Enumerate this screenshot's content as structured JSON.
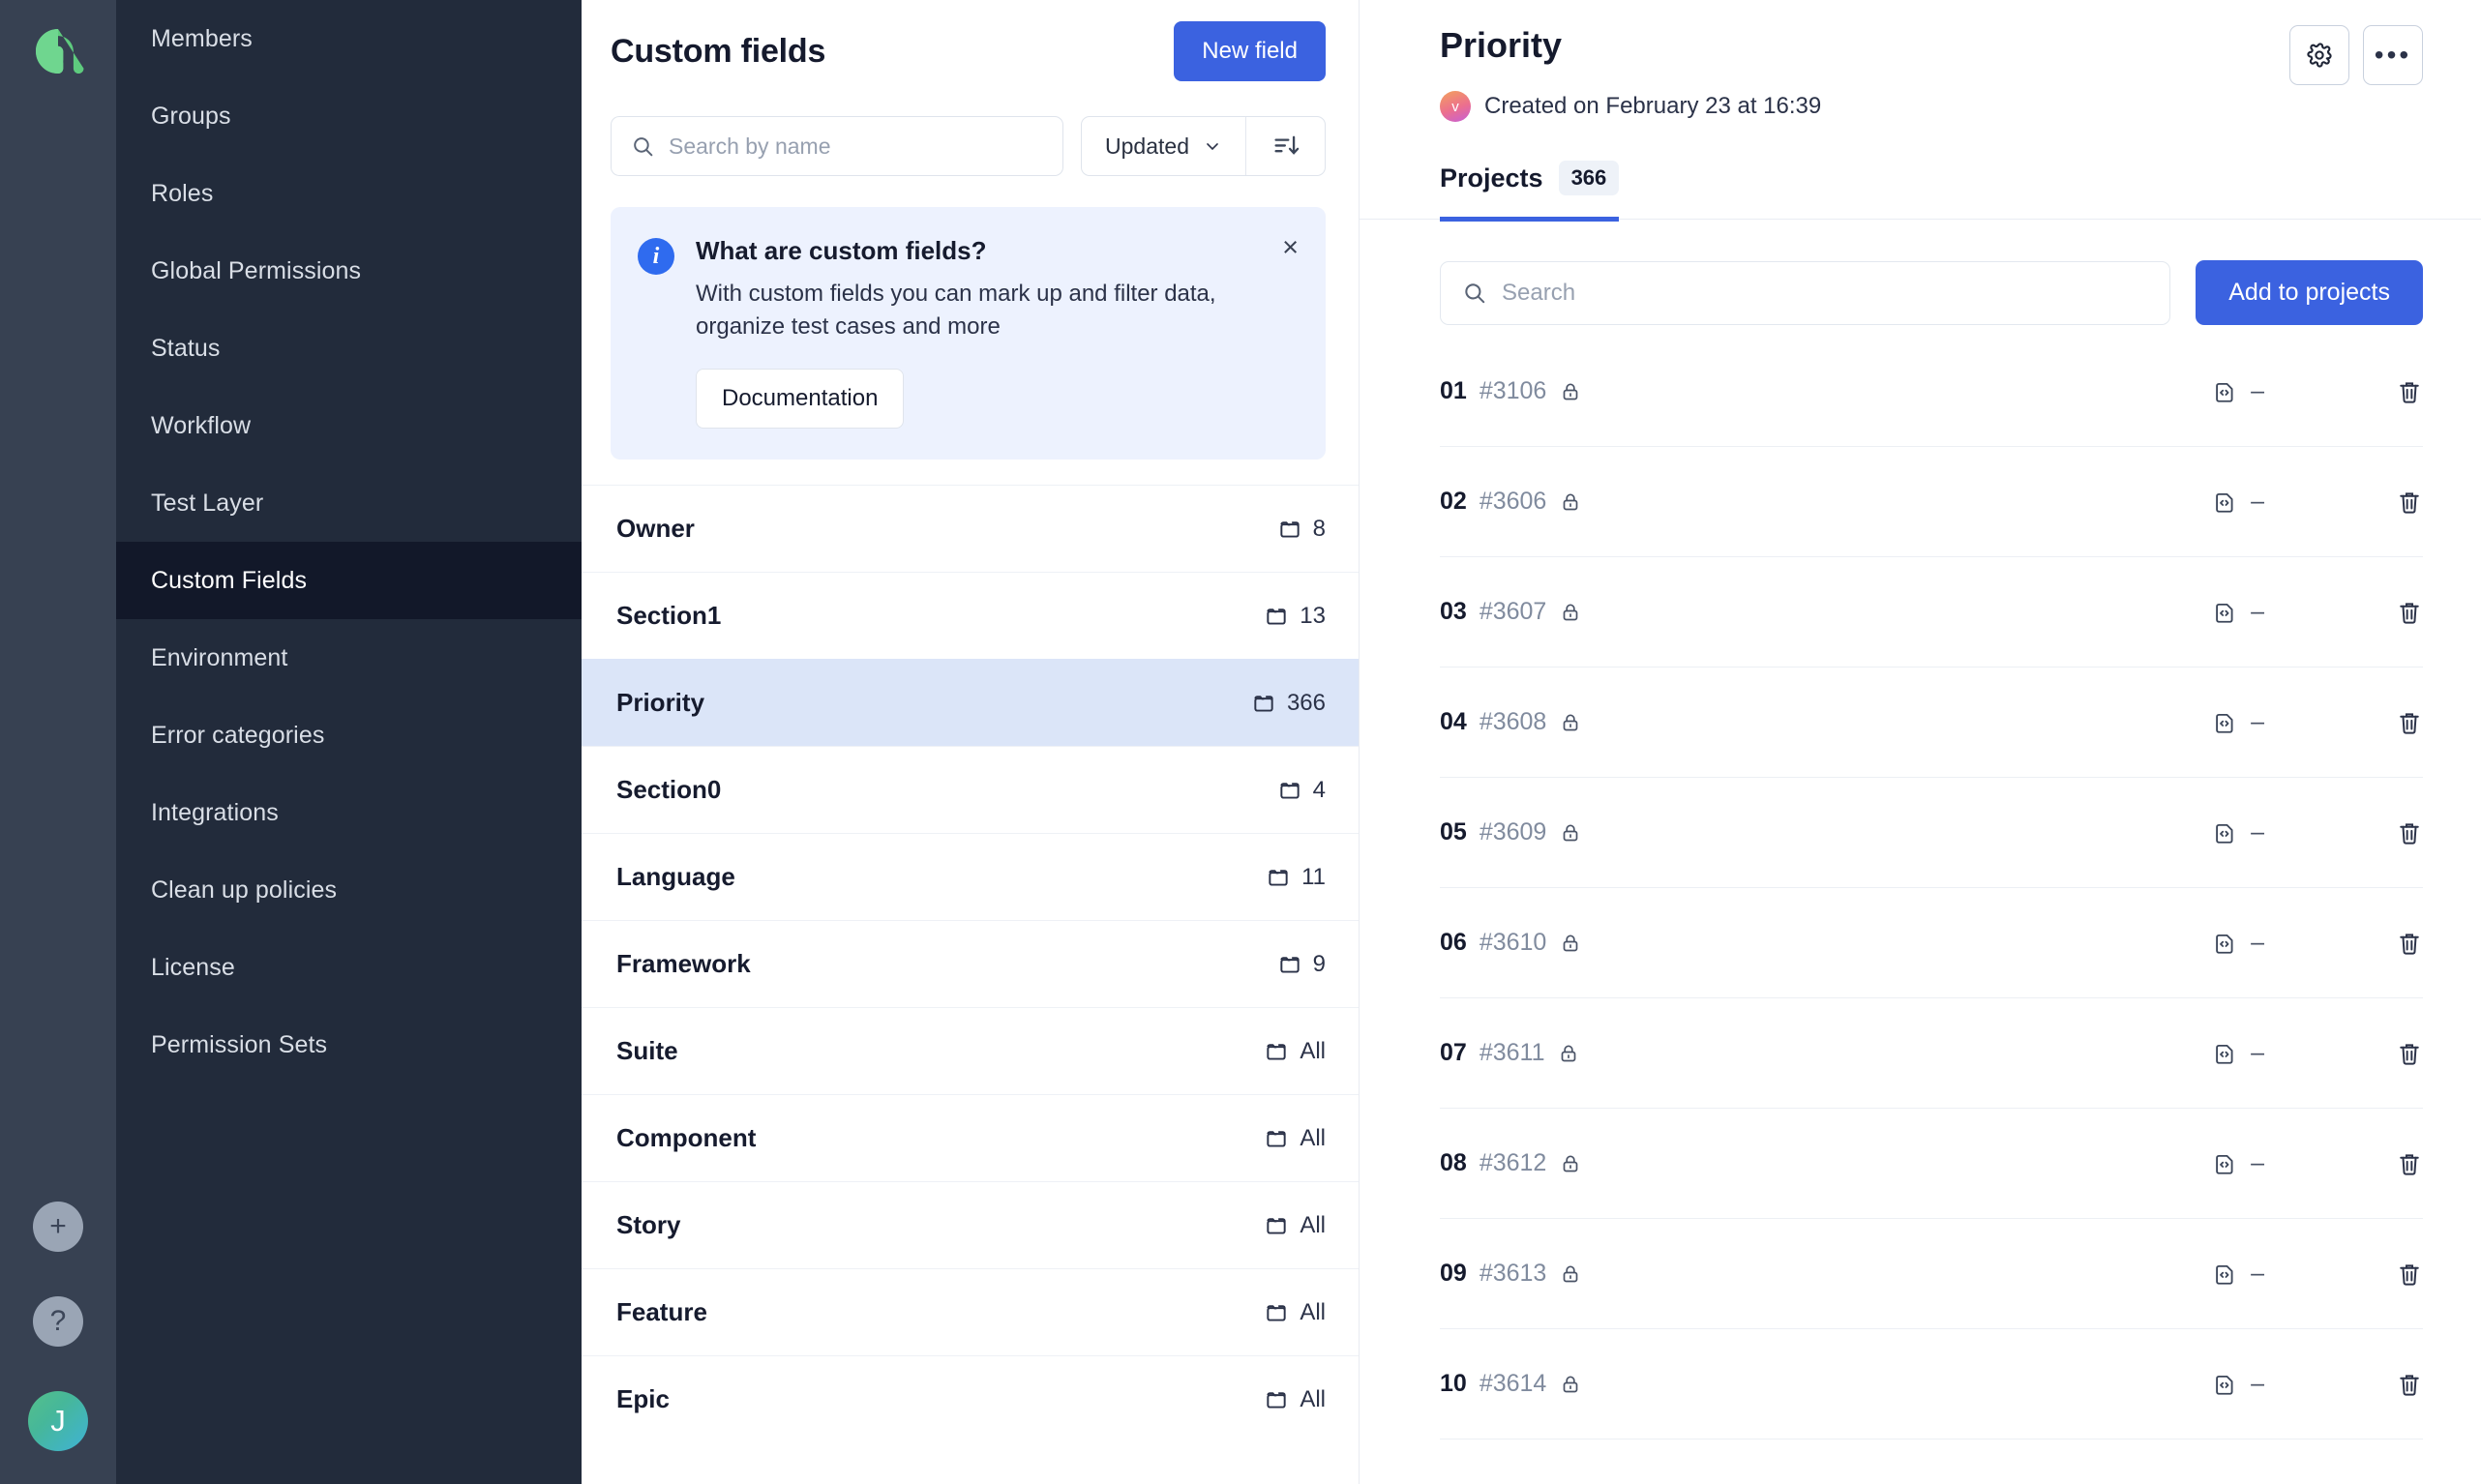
{
  "rail": {
    "logo": "app-logo",
    "add_label": "+",
    "help_label": "?",
    "user_initial": "J"
  },
  "sidebar": {
    "items": [
      {
        "label": "Members",
        "active": false
      },
      {
        "label": "Groups",
        "active": false
      },
      {
        "label": "Roles",
        "active": false
      },
      {
        "label": "Global Permissions",
        "active": false
      },
      {
        "label": "Status",
        "active": false
      },
      {
        "label": "Workflow",
        "active": false
      },
      {
        "label": "Test Layer",
        "active": false
      },
      {
        "label": "Custom Fields",
        "active": true
      },
      {
        "label": "Environment",
        "active": false
      },
      {
        "label": "Error categories",
        "active": false
      },
      {
        "label": "Integrations",
        "active": false
      },
      {
        "label": "Clean up policies",
        "active": false
      },
      {
        "label": "License",
        "active": false
      },
      {
        "label": "Permission Sets",
        "active": false
      }
    ]
  },
  "middle": {
    "title": "Custom fields",
    "new_field_label": "New field",
    "search_placeholder": "Search by name",
    "search_value": "",
    "sort_by": "Updated",
    "sort_direction_icon": "sort-descending-icon",
    "info": {
      "title": "What are custom fields?",
      "body": "With custom fields you can mark up and filter data, organize test cases and more",
      "button_label": "Documentation",
      "close_label": "×"
    },
    "fields": [
      {
        "name": "Owner",
        "count": "8",
        "selected": false
      },
      {
        "name": "Section1",
        "count": "13",
        "selected": false
      },
      {
        "name": "Priority",
        "count": "366",
        "selected": true
      },
      {
        "name": "Section0",
        "count": "4",
        "selected": false
      },
      {
        "name": "Language",
        "count": "11",
        "selected": false
      },
      {
        "name": "Framework",
        "count": "9",
        "selected": false
      },
      {
        "name": "Suite",
        "count": "All",
        "selected": false
      },
      {
        "name": "Component",
        "count": "All",
        "selected": false
      },
      {
        "name": "Story",
        "count": "All",
        "selected": false
      },
      {
        "name": "Feature",
        "count": "All",
        "selected": false
      },
      {
        "name": "Epic",
        "count": "All",
        "selected": false
      }
    ]
  },
  "detail": {
    "title": "Priority",
    "created_by_initial": "v",
    "created_text": "Created on February 23 at 16:39",
    "settings_icon": "gear-icon",
    "more_icon": "ellipsis-icon",
    "tab": {
      "label": "Projects",
      "count": "366"
    },
    "search_placeholder": "Search",
    "search_value": "",
    "add_to_projects_label": "Add to projects",
    "projects": [
      {
        "index": "01",
        "id": "#3106",
        "lock": "lock-icon",
        "value": "–"
      },
      {
        "index": "02",
        "id": "#3606",
        "lock": "lock-icon",
        "value": "–"
      },
      {
        "index": "03",
        "id": "#3607",
        "lock": "lock-icon",
        "value": "–"
      },
      {
        "index": "04",
        "id": "#3608",
        "lock": "lock-icon",
        "value": "–"
      },
      {
        "index": "05",
        "id": "#3609",
        "lock": "lock-icon",
        "value": "–"
      },
      {
        "index": "06",
        "id": "#3610",
        "lock": "lock-icon",
        "value": "–"
      },
      {
        "index": "07",
        "id": "#3611",
        "lock": "lock-icon",
        "value": "–"
      },
      {
        "index": "08",
        "id": "#3612",
        "lock": "lock-icon",
        "value": "–"
      },
      {
        "index": "09",
        "id": "#3613",
        "lock": "lock-icon",
        "value": "–"
      },
      {
        "index": "10",
        "id": "#3614",
        "lock": "lock-icon",
        "value": "–"
      }
    ]
  },
  "colors": {
    "accent": "#3B62E0",
    "rail_bg": "#374152",
    "nav_bg": "#222B3B",
    "nav_active_bg": "#121829",
    "selected_row_bg": "#DBE5F8",
    "info_bg": "#EDF2FE",
    "logo_green": "#5ECB7E"
  }
}
